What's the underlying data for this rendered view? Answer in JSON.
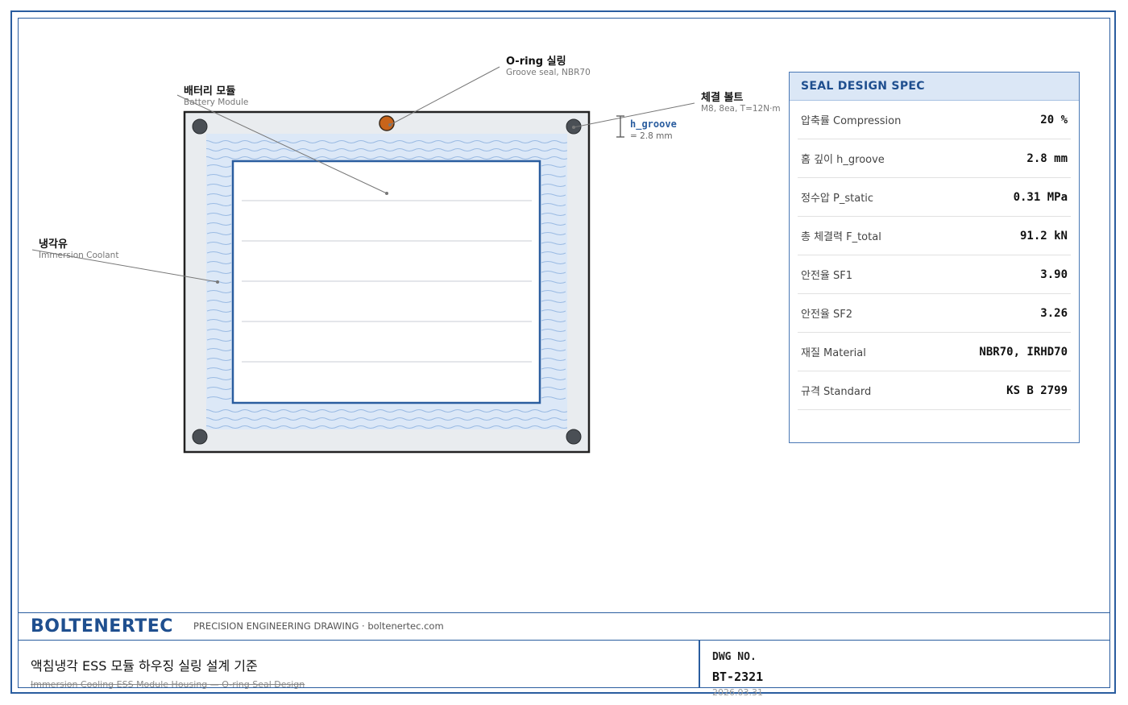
{
  "callouts": {
    "oring": {
      "title": "O-ring 실링",
      "sub": "Groove seal, NBR70"
    },
    "battery": {
      "title": "배터리 모듈",
      "sub": "Battery Module"
    },
    "bolt": {
      "title": "체결 볼트",
      "sub": "M8, 8ea, T=12N·m"
    },
    "coolant": {
      "title": "냉각유",
      "sub": "Immersion Coolant"
    }
  },
  "dimension": {
    "label": "h_groove",
    "value": "= 2.8 mm"
  },
  "spec": {
    "title": "SEAL DESIGN SPEC",
    "rows": [
      {
        "label": "압축률 Compression",
        "value": "20 %"
      },
      {
        "label": "홈 깊이 h_groove",
        "value": "2.8 mm"
      },
      {
        "label": "정수압 P_static",
        "value": "0.31 MPa"
      },
      {
        "label": "총 체결력 F_total",
        "value": "91.2 kN"
      },
      {
        "label": "안전율 SF1",
        "value": "3.90"
      },
      {
        "label": "안전율 SF2",
        "value": "3.26"
      },
      {
        "label": "재질 Material",
        "value": "NBR70, IRHD70"
      },
      {
        "label": "규격 Standard",
        "value": "KS B 2799"
      }
    ]
  },
  "titleblock": {
    "brand": "BOLTENERTEC",
    "tagline": "PRECISION ENGINEERING DRAWING · boltenertec.com",
    "title": "액침냉각 ESS 모듈 하우징 실링 설계 기준",
    "subtitle": "Immersion Cooling ESS Module Housing — O-ring Seal Design",
    "dwg_label": "DWG NO.",
    "dwg_number": "BT-2321",
    "date": "2026.03.31"
  },
  "colors": {
    "accent": "#2a5d9f",
    "oring": "#c8641a",
    "bolt": "#4a4f55",
    "coolant": "#dce8f7"
  }
}
